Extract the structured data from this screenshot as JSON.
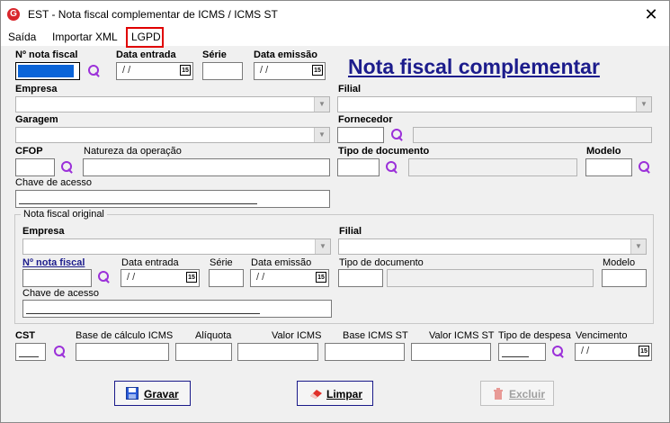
{
  "window": {
    "title": "EST - Nota fiscal complementar de ICMS / ICMS ST",
    "app_icon": "G"
  },
  "menu": {
    "items": [
      "Saída",
      "Importar XML",
      "LGPD"
    ]
  },
  "header_title": "Nota fiscal complementar",
  "labels": {
    "numero_nf": "Nº nota fiscal",
    "data_entrada": "Data entrada",
    "serie": "Série",
    "data_emissao": "Data emissão",
    "empresa": "Empresa",
    "filial": "Filial",
    "garagem": "Garagem",
    "fornecedor": "Fornecedor",
    "cfop": "CFOP",
    "natureza": "Natureza da operação",
    "tipo_documento": "Tipo de documento",
    "modelo": "Modelo",
    "chave_acesso": "Chave de acesso"
  },
  "original": {
    "group_title": "Nota fiscal original",
    "empresa": "Empresa",
    "filial": "Filial",
    "numero_nf": "Nº nota fiscal",
    "data_entrada": "Data entrada",
    "serie": "Série",
    "data_emissao": "Data emissão",
    "tipo_documento": "Tipo de documento",
    "modelo": "Modelo",
    "chave_acesso": "Chave de acesso"
  },
  "totals": {
    "cst": "CST",
    "base_icms": "Base de cálculo ICMS",
    "aliquota": "Alíquota",
    "valor_icms": "Valor ICMS",
    "base_icms_st": "Base ICMS ST",
    "valor_icms_st": "Valor ICMS ST",
    "tipo_despesa": "Tipo de despesa",
    "vencimento": "Vencimento"
  },
  "date_placeholder": "/ /",
  "calendar_icon_text": "15",
  "buttons": {
    "gravar": "Gravar",
    "limpar": "Limpar",
    "excluir": "Excluir"
  },
  "colors": {
    "accent": "#1c1c8c",
    "search_icon": "#9b30d9",
    "highlight": "#e00000",
    "selection": "#0a64d8"
  }
}
